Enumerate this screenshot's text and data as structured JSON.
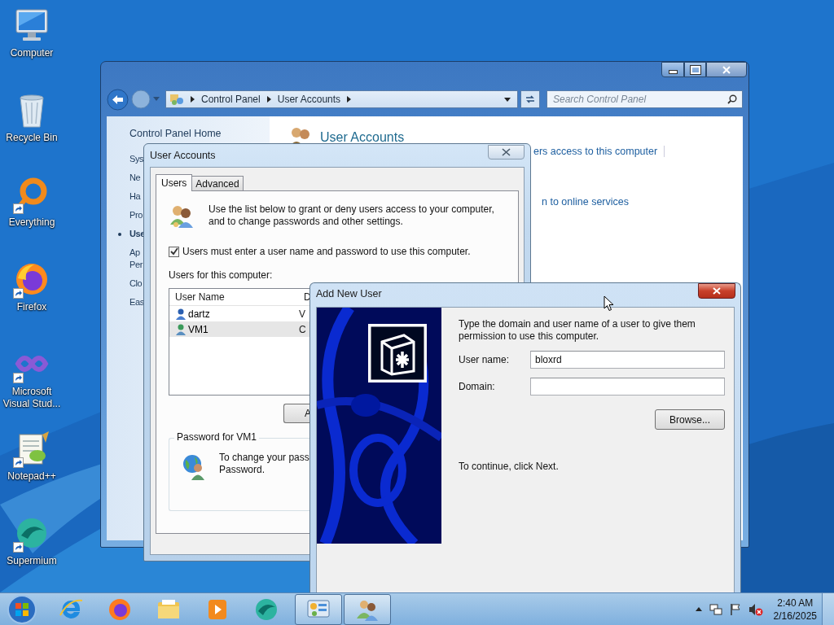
{
  "desktop_icons": [
    {
      "label": "Computer",
      "kind": "computer",
      "shortcut": false
    },
    {
      "label": "Recycle Bin",
      "kind": "recycle",
      "shortcut": false
    },
    {
      "label": "Everything",
      "kind": "ring",
      "shortcut": true
    },
    {
      "label": "Firefox",
      "kind": "firefox",
      "shortcut": true
    },
    {
      "label": "Microsoft Visual Stud...",
      "kind": "infinity",
      "shortcut": true
    },
    {
      "label": "Notepad++",
      "kind": "notepad",
      "shortcut": true
    },
    {
      "label": "Supermium",
      "kind": "supermium",
      "shortcut": true
    }
  ],
  "control_panel": {
    "breadcrumb": [
      "Control Panel",
      "User Accounts"
    ],
    "search": {
      "placeholder": "Search Control Panel"
    },
    "sidebar": {
      "home": "Control Panel Home",
      "items": [
        {
          "label": "Sys",
          "selected": false
        },
        {
          "label": "Ne",
          "selected": false
        },
        {
          "label": "Ha",
          "selected": false
        },
        {
          "label": "Pro",
          "selected": false
        },
        {
          "label": "Use",
          "selected": true
        },
        {
          "label": "Ap Per",
          "selected": false
        },
        {
          "label": "Clo",
          "selected": false
        },
        {
          "label": "Eas",
          "selected": false
        }
      ]
    },
    "heading": "User Accounts",
    "links": [
      "ers access to this computer",
      "n to online services"
    ]
  },
  "user_accounts_dialog": {
    "title": "User Accounts",
    "tabs": [
      {
        "label": "Users",
        "selected": true
      },
      {
        "label": "Advanced",
        "selected": false
      }
    ],
    "intro": "Use the list below to grant or deny users access to your computer, and to change passwords and other settings.",
    "require_login": {
      "label": "Users must enter a user name and password to use this computer.",
      "checked": true
    },
    "list_label": "Users for this computer:",
    "columns": [
      "User Name",
      "D"
    ],
    "rows": [
      {
        "cells": [
          "dartz",
          "V"
        ],
        "selected": false
      },
      {
        "cells": [
          "VM1",
          "C"
        ],
        "selected": true
      }
    ],
    "button": "A",
    "password_group": {
      "title": "Password for VM1",
      "lines": [
        "To change your pass",
        "Password."
      ]
    }
  },
  "add_new_user": {
    "title": "Add New User",
    "intro": "Type the domain and user name of a user to give them permission to use this computer.",
    "fields": [
      {
        "label": "User name:",
        "value": "bloxrd"
      },
      {
        "label": "Domain:"
      }
    ],
    "browse": "Browse...",
    "hint": "To continue, click Next."
  },
  "taskbar": {
    "apps": [
      {
        "kind": "ie",
        "active": false
      },
      {
        "kind": "firefox",
        "active": false
      },
      {
        "kind": "explorer",
        "active": false
      },
      {
        "kind": "media",
        "active": false
      },
      {
        "kind": "supermium",
        "active": false
      },
      {
        "kind": "control_panel",
        "active": true
      },
      {
        "kind": "users",
        "active": true
      }
    ],
    "time": "2:40 AM",
    "date": "2/16/2025"
  }
}
